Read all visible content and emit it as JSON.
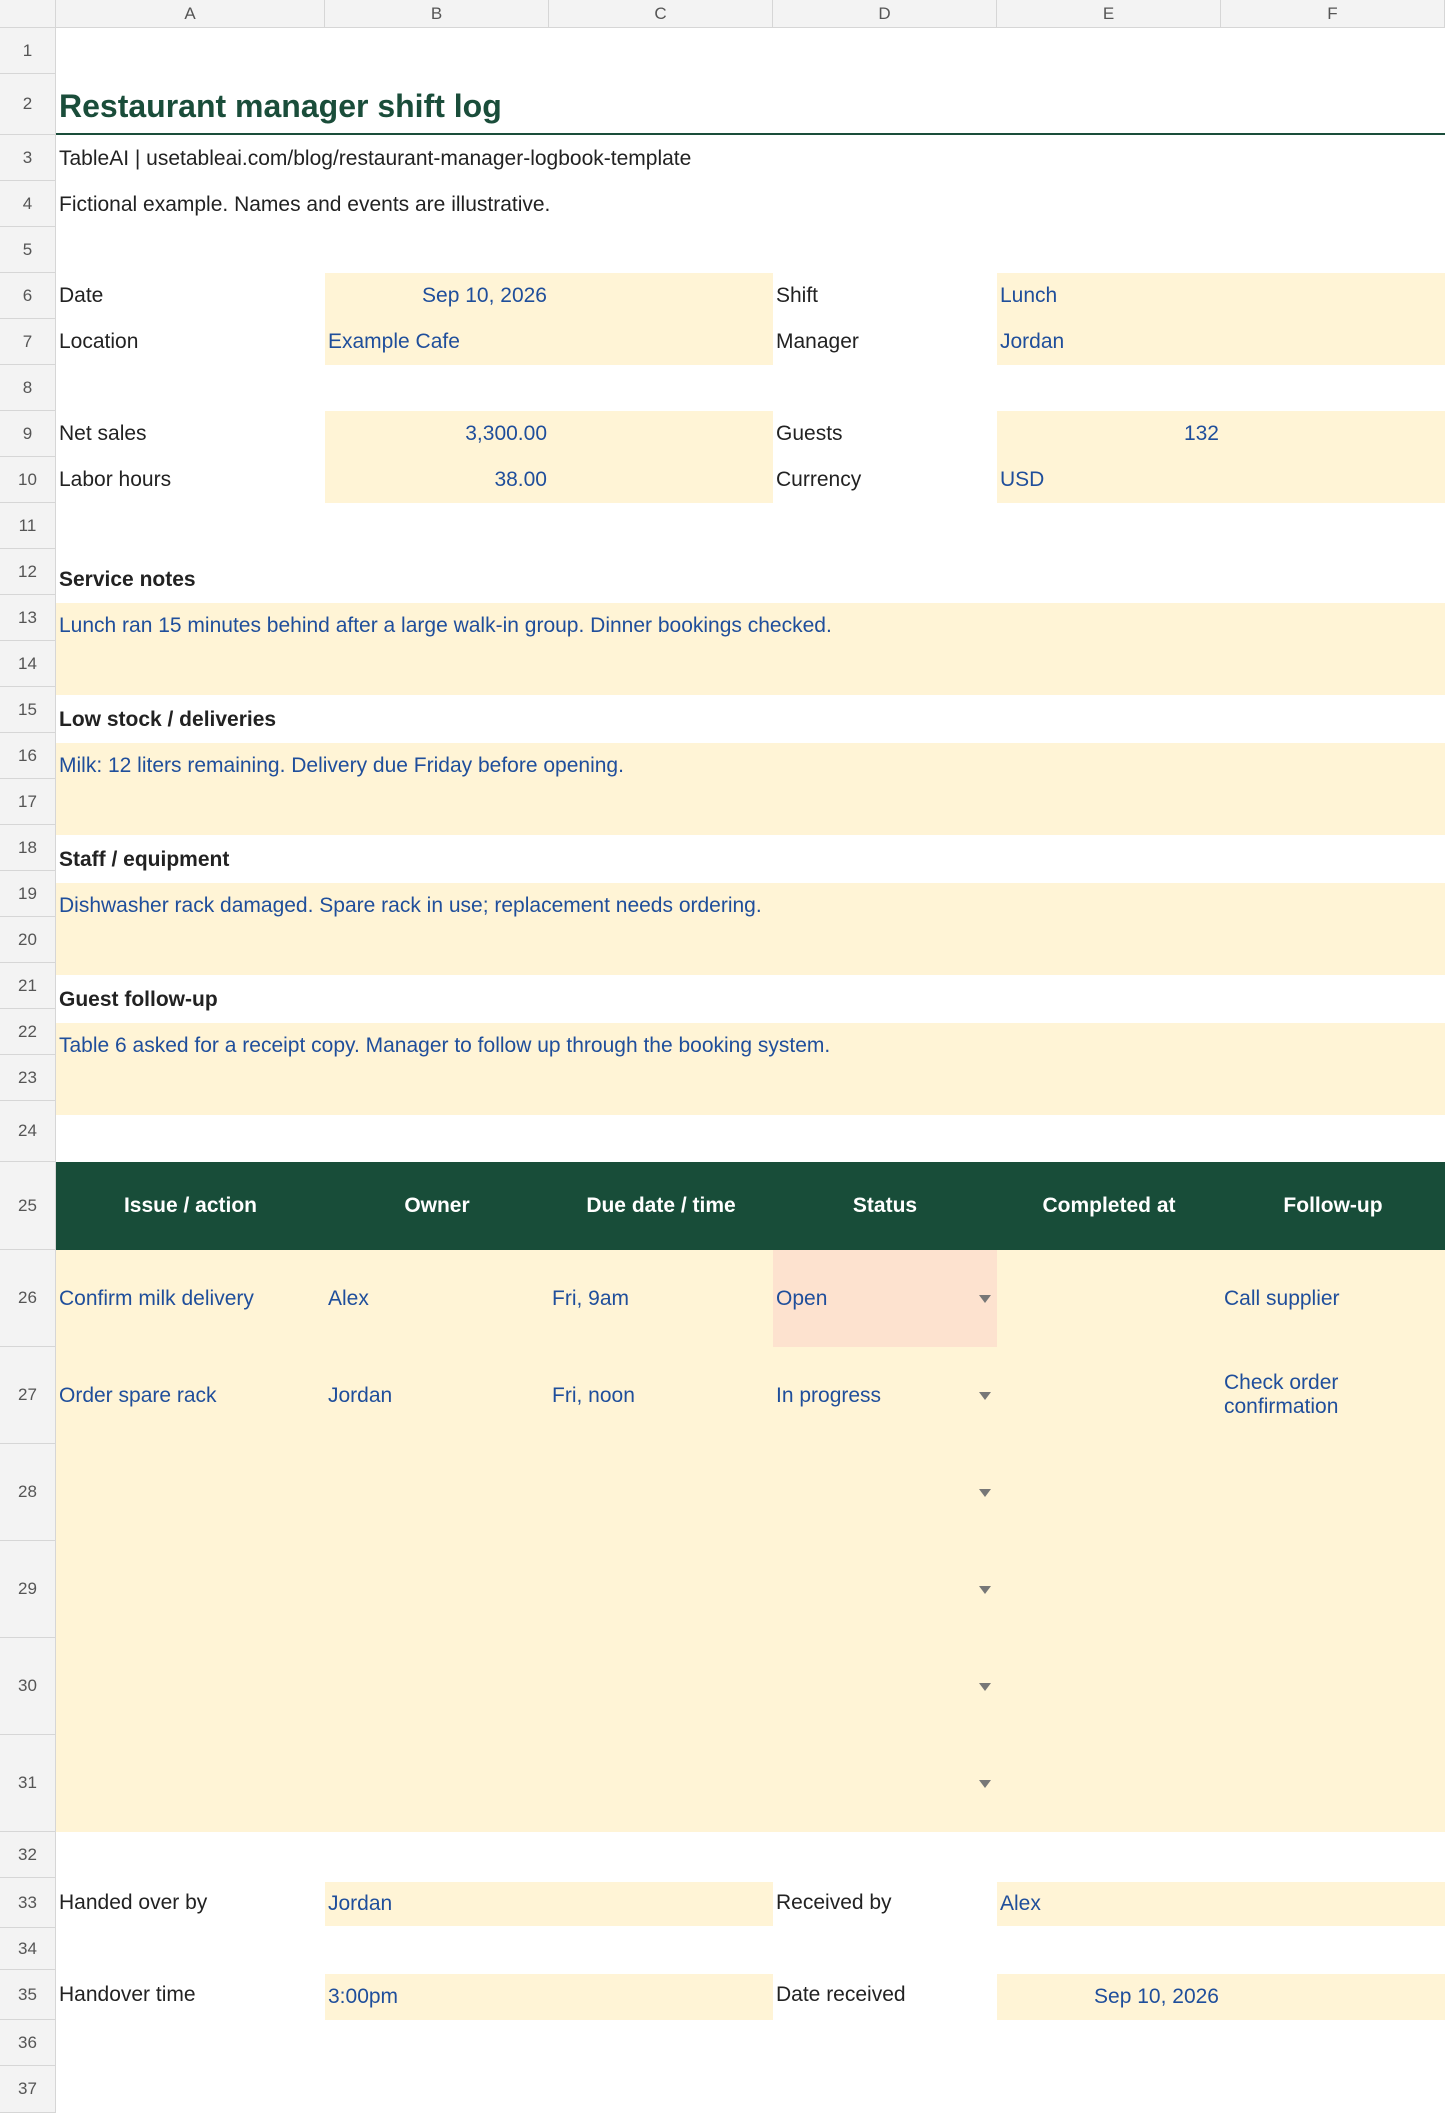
{
  "columns": [
    "A",
    "B",
    "C",
    "D",
    "E",
    "F"
  ],
  "rows": [
    "1",
    "2",
    "3",
    "4",
    "5",
    "6",
    "7",
    "8",
    "9",
    "10",
    "11",
    "12",
    "13",
    "14",
    "15",
    "16",
    "17",
    "18",
    "19",
    "20",
    "21",
    "22",
    "23",
    "24",
    "25",
    "26",
    "27",
    "28",
    "29",
    "30",
    "31",
    "32",
    "33",
    "34",
    "35",
    "36",
    "37"
  ],
  "title": "Restaurant manager shift log",
  "source_line": "TableAI | usetableai.com/blog/restaurant-manager-logbook-template",
  "disclaimer": "Fictional example. Names and events are illustrative.",
  "header_fields": {
    "date_label": "Date",
    "date_value": "Sep 10, 2026",
    "shift_label": "Shift",
    "shift_value": "Lunch",
    "location_label": "Location",
    "location_value": "Example Cafe",
    "manager_label": "Manager",
    "manager_value": "Jordan",
    "net_sales_label": "Net sales",
    "net_sales_value": "3,300.00",
    "guests_label": "Guests",
    "guests_value": "132",
    "labor_hours_label": "Labor hours",
    "labor_hours_value": "38.00",
    "currency_label": "Currency",
    "currency_value": "USD"
  },
  "sections": [
    {
      "heading": "Service notes",
      "text": "Lunch ran 15 minutes behind after a large walk-in group. Dinner bookings checked."
    },
    {
      "heading": "Low stock / deliveries",
      "text": "Milk: 12 liters remaining. Delivery due Friday before opening."
    },
    {
      "heading": "Staff / equipment",
      "text": "Dishwasher rack damaged. Spare rack in use; replacement needs ordering."
    },
    {
      "heading": "Guest follow-up",
      "text": "Table 6 asked for a receipt copy. Manager to follow up through the booking system."
    }
  ],
  "action_table": {
    "headers": [
      "Issue / action",
      "Owner",
      "Due date / time",
      "Status",
      "Completed at",
      "Follow-up"
    ],
    "rows": [
      {
        "issue": "Confirm milk delivery",
        "owner": "Alex",
        "due": "Fri, 9am",
        "status": "Open",
        "completed": "",
        "followup": "Call supplier"
      },
      {
        "issue": "Order spare rack",
        "owner": "Jordan",
        "due": "Fri, noon",
        "status": "In progress",
        "completed": "",
        "followup_line1": "Check order",
        "followup_line2": "confirmation"
      }
    ]
  },
  "handover": {
    "handed_over_label": "Handed over by",
    "handed_over_value": "Jordan",
    "received_label": "Received by",
    "received_value": "Alex",
    "time_label": "Handover time",
    "time_value": "3:00pm",
    "date_received_label": "Date received",
    "date_received_value": "Sep 10, 2026"
  },
  "colors": {
    "accent": "#184d39",
    "input_fill": "#fff4d6",
    "open_status": "#fde2cf",
    "input_text": "#1f4e9b"
  }
}
